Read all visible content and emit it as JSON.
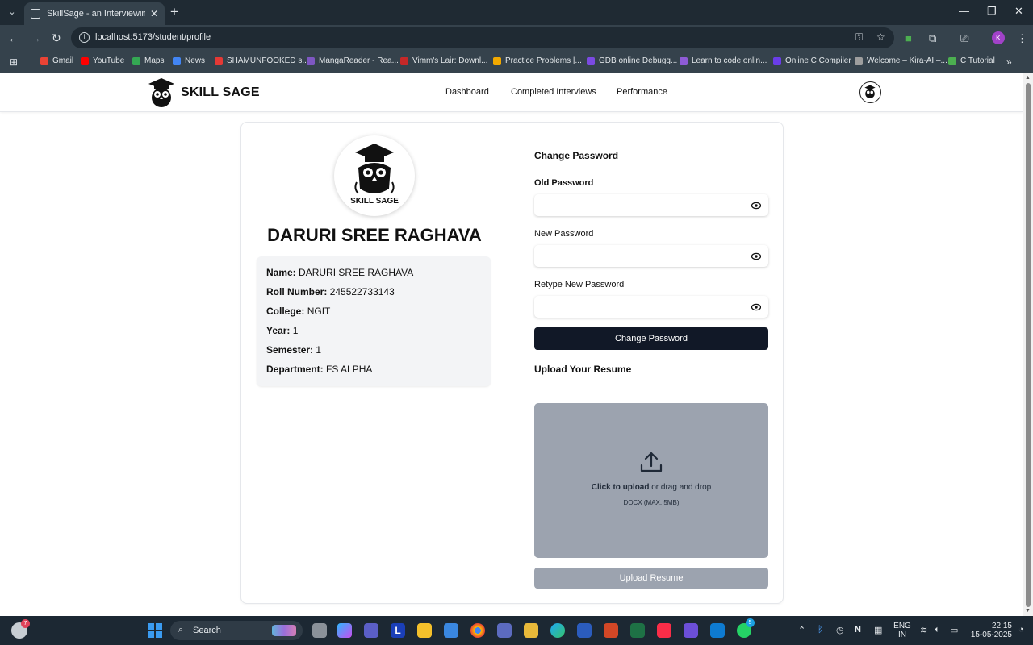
{
  "browser": {
    "tab_title": "SkillSage - an Interviewing Platf",
    "url": "localhost:5173/student/profile",
    "profile_initial": "K",
    "bookmarks": [
      {
        "label": "Gmail",
        "color": "#ea4335"
      },
      {
        "label": "YouTube",
        "color": "#ff0000"
      },
      {
        "label": "Maps",
        "color": "#34a853"
      },
      {
        "label": "News",
        "color": "#4285f4"
      },
      {
        "label": "SHAMUNFOOKED s...",
        "color": "#e53935"
      },
      {
        "label": "MangaReader - Rea...",
        "color": "#7e57c2"
      },
      {
        "label": "Vimm's Lair: Downl...",
        "color": "#c62828"
      },
      {
        "label": "Practice Problems |...",
        "color": "#f2a900"
      },
      {
        "label": "GDB online Debugg...",
        "color": "#7b4ae2"
      },
      {
        "label": "Learn to code onlin...",
        "color": "#8e5bd6"
      },
      {
        "label": "Online C Compiler",
        "color": "#6a3de8"
      },
      {
        "label": "Welcome – Kira-AI –...",
        "color": "#9e9e9e"
      },
      {
        "label": "C Tutorial",
        "color": "#4caf50"
      }
    ]
  },
  "nav": {
    "brand": "SKILL SAGE",
    "links": [
      "Dashboard",
      "Completed Interviews",
      "Performance"
    ]
  },
  "profile": {
    "avatar_caption": "SKILL SAGE",
    "full_name": "DARURI SREE RAGHAVA",
    "fields": [
      {
        "label": "Name:",
        "value": "DARURI SREE RAGHAVA"
      },
      {
        "label": "Roll Number:",
        "value": "245522733143"
      },
      {
        "label": "College:",
        "value": "NGIT"
      },
      {
        "label": "Year:",
        "value": "1"
      },
      {
        "label": "Semester:",
        "value": "1"
      },
      {
        "label": "Department:",
        "value": "FS ALPHA"
      }
    ]
  },
  "password": {
    "title": "Change Password",
    "old_label": "Old Password",
    "new_label": "New Password",
    "retype_label": "Retype New Password",
    "old_value": "",
    "new_value": "",
    "retype_value": "",
    "submit_label": "Change Password"
  },
  "resume": {
    "title": "Upload Your Resume",
    "click_text": "Click to upload",
    "drag_text": " or drag and drop",
    "hint": "DOCX (MAX. 5MB)",
    "button_label": "Upload Resume"
  },
  "taskbar": {
    "weather_badge": "7",
    "search_label": "Search",
    "notif_badge": "5",
    "lang_top": "ENG",
    "lang_bottom": "IN",
    "time": "22:15",
    "date": "15-05-2025"
  }
}
